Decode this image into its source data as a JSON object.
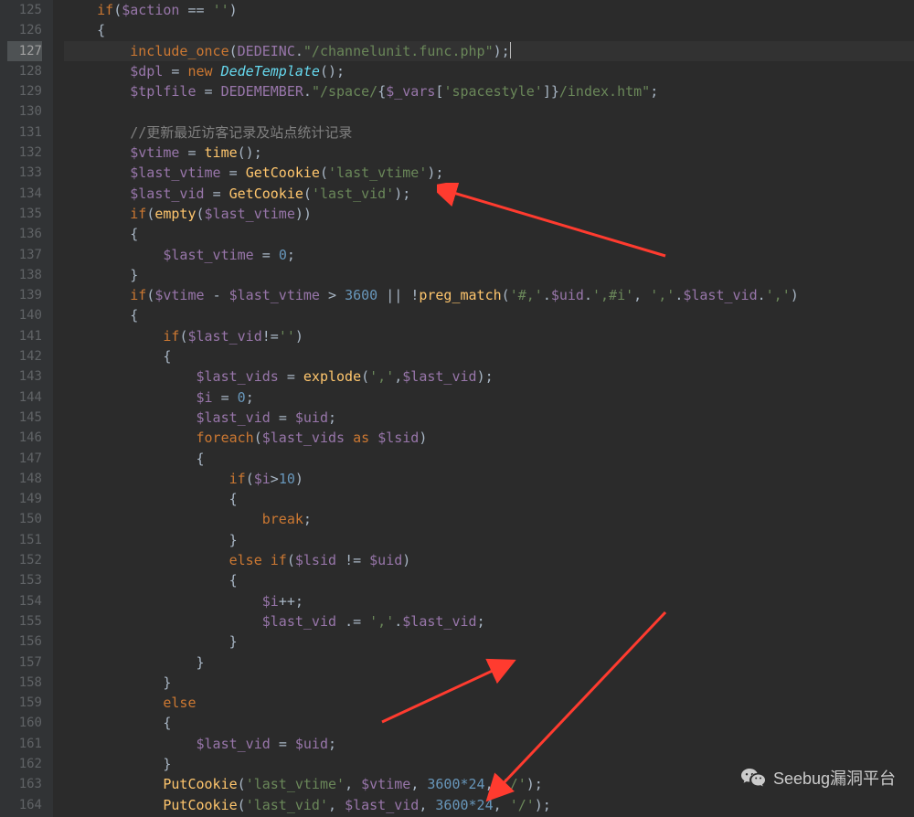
{
  "line_start": 125,
  "line_end": 164,
  "current_line": 127,
  "watermark": "Seebug漏洞平台",
  "tokens": {
    "l125": {
      "kw_if": "if",
      "var_action": "$action",
      "op_eq": "==",
      "str_empty": "''"
    },
    "l127": {
      "kw_include": "include_once",
      "const_dedeinc": "DEDEINC",
      "str_path": "\"/channelunit.func.php\""
    },
    "l128": {
      "var_dpl": "$dpl",
      "op_eq": "=",
      "kw_new": "new",
      "class_dt": "DedeTemplate"
    },
    "l129": {
      "var_tplfile": "$tplfile",
      "op_eq": "=",
      "const_dm": "DEDEMEMBER",
      "str_s1": "\"/space/",
      "ob": "{",
      "var_v": "$_vars",
      "str_key": "'spacestyle'",
      "cb": "}",
      "str_s2": "/index.htm\""
    },
    "l131": {
      "comment": "//更新最近访客记录及站点统计记录"
    },
    "l132": {
      "var_vtime": "$vtime",
      "op_eq": "=",
      "func_time": "time"
    },
    "l133": {
      "var_lvtime": "$last_vtime",
      "op_eq": "=",
      "func_gc": "GetCookie",
      "str_arg": "'last_vtime'"
    },
    "l134": {
      "var_lvid": "$last_vid",
      "op_eq": "=",
      "func_gc": "GetCookie",
      "str_arg": "'last_vid'"
    },
    "l135": {
      "kw_if": "if",
      "func_empty": "empty",
      "var_lvtime": "$last_vtime"
    },
    "l137": {
      "var_lvtime": "$last_vtime",
      "op_eq": "=",
      "num_0": "0"
    },
    "l139": {
      "kw_if": "if",
      "var_vtime": "$vtime",
      "op_minus": "-",
      "var_lvtime": "$last_vtime",
      "op_gt": ">",
      "num_3600": "3600",
      "op_or": "||",
      "op_not": "!",
      "func_pm": "preg_match",
      "str_p1": "'#,'",
      "var_uid": "$uid",
      "str_p2": "',#i'",
      "str_c": "','",
      "var_lvid": "$last_vid",
      "str_c2": "','"
    },
    "l141": {
      "kw_if": "if",
      "var_lvid": "$last_vid",
      "op_ne": "!=",
      "str_e": "''"
    },
    "l143": {
      "var_lvids": "$last_vids",
      "op_eq": "=",
      "func_exp": "explode",
      "str_c": "','",
      "var_lvid": "$last_vid"
    },
    "l144": {
      "var_i": "$i",
      "op_eq": "=",
      "num_0": "0"
    },
    "l145": {
      "var_lvid": "$last_vid",
      "op_eq": "=",
      "var_uid": "$uid"
    },
    "l146": {
      "kw_foreach": "foreach",
      "var_lvids": "$last_vids",
      "kw_as": "as",
      "var_lsid": "$lsid"
    },
    "l148": {
      "kw_if": "if",
      "var_i": "$i",
      "op_gt": ">",
      "num_10": "10"
    },
    "l150": {
      "kw_break": "break"
    },
    "l152": {
      "kw_else": "else",
      "kw_if": "if",
      "var_lsid": "$lsid",
      "op_ne": "!=",
      "var_uid": "$uid"
    },
    "l154": {
      "var_i": "$i",
      "op_pp": "++"
    },
    "l155": {
      "var_lvid": "$last_vid",
      "op_ceq": ".=",
      "str_c": "','",
      "var_lvid2": "$last_vid"
    },
    "l159": {
      "kw_else": "else"
    },
    "l161": {
      "var_lvid": "$last_vid",
      "op_eq": "=",
      "var_uid": "$uid"
    },
    "l163": {
      "func_pc": "PutCookie",
      "str_a1": "'last_vtime'",
      "var_vtime": "$vtime",
      "num_e": "3600*24",
      "str_s": "'/'"
    },
    "l164": {
      "func_pc": "PutCookie",
      "str_a1": "'last_vid'",
      "var_lvid": "$last_vid",
      "num_e": "3600*24",
      "str_s": "'/'"
    }
  }
}
